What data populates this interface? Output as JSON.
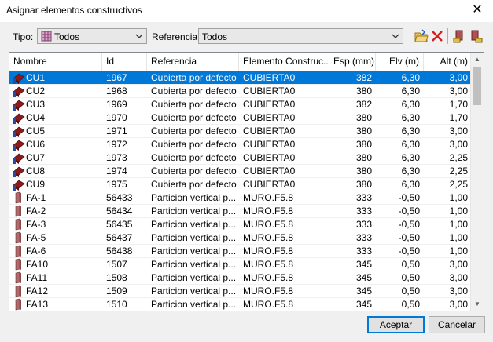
{
  "window": {
    "title": "Asignar elementos constructivos",
    "close_glyph": "✕"
  },
  "filters": {
    "tipo_label": "Tipo:",
    "tipo_value": "Todos",
    "referencia_label": "Referencia:",
    "referencia_value": "Todos"
  },
  "toolbar_icons": [
    "folder-open-icon",
    "delete-x-icon",
    "import-element-icon",
    "export-element-icon"
  ],
  "table": {
    "columns": [
      "Nombre",
      "Id",
      "Referencia",
      "Elemento Construc...",
      "Esp (mm)",
      "Elv (m)",
      "Alt (m)"
    ],
    "rows": [
      {
        "nombre": "CU1",
        "id": "1967",
        "ref": "Cubierta por defecto",
        "elem": "CUBIERTA0",
        "esp": "382",
        "elv": "6,30",
        "alt": "3,00",
        "kind": "roof",
        "selected": true
      },
      {
        "nombre": "CU2",
        "id": "1968",
        "ref": "Cubierta por defecto",
        "elem": "CUBIERTA0",
        "esp": "380",
        "elv": "6,30",
        "alt": "3,00",
        "kind": "roof"
      },
      {
        "nombre": "CU3",
        "id": "1969",
        "ref": "Cubierta por defecto",
        "elem": "CUBIERTA0",
        "esp": "382",
        "elv": "6,30",
        "alt": "1,70",
        "kind": "roof"
      },
      {
        "nombre": "CU4",
        "id": "1970",
        "ref": "Cubierta por defecto",
        "elem": "CUBIERTA0",
        "esp": "380",
        "elv": "6,30",
        "alt": "1,70",
        "kind": "roof"
      },
      {
        "nombre": "CU5",
        "id": "1971",
        "ref": "Cubierta por defecto",
        "elem": "CUBIERTA0",
        "esp": "380",
        "elv": "6,30",
        "alt": "3,00",
        "kind": "roof"
      },
      {
        "nombre": "CU6",
        "id": "1972",
        "ref": "Cubierta por defecto",
        "elem": "CUBIERTA0",
        "esp": "380",
        "elv": "6,30",
        "alt": "3,00",
        "kind": "roof"
      },
      {
        "nombre": "CU7",
        "id": "1973",
        "ref": "Cubierta por defecto",
        "elem": "CUBIERTA0",
        "esp": "380",
        "elv": "6,30",
        "alt": "2,25",
        "kind": "roof"
      },
      {
        "nombre": "CU8",
        "id": "1974",
        "ref": "Cubierta por defecto",
        "elem": "CUBIERTA0",
        "esp": "380",
        "elv": "6,30",
        "alt": "2,25",
        "kind": "roof"
      },
      {
        "nombre": "CU9",
        "id": "1975",
        "ref": "Cubierta por defecto",
        "elem": "CUBIERTA0",
        "esp": "380",
        "elv": "6,30",
        "alt": "2,25",
        "kind": "roof"
      },
      {
        "nombre": "FA-1",
        "id": "56433",
        "ref": "Particion vertical p...",
        "elem": "MURO.F5.8",
        "esp": "333",
        "elv": "-0,50",
        "alt": "1,00",
        "kind": "wall"
      },
      {
        "nombre": "FA-2",
        "id": "56434",
        "ref": "Particion vertical p...",
        "elem": "MURO.F5.8",
        "esp": "333",
        "elv": "-0,50",
        "alt": "1,00",
        "kind": "wall"
      },
      {
        "nombre": "FA-3",
        "id": "56435",
        "ref": "Particion vertical p...",
        "elem": "MURO.F5.8",
        "esp": "333",
        "elv": "-0,50",
        "alt": "1,00",
        "kind": "wall"
      },
      {
        "nombre": "FA-5",
        "id": "56437",
        "ref": "Particion vertical p...",
        "elem": "MURO.F5.8",
        "esp": "333",
        "elv": "-0,50",
        "alt": "1,00",
        "kind": "wall"
      },
      {
        "nombre": "FA-6",
        "id": "56438",
        "ref": "Particion vertical p...",
        "elem": "MURO.F5.8",
        "esp": "333",
        "elv": "-0,50",
        "alt": "1,00",
        "kind": "wall"
      },
      {
        "nombre": "FA10",
        "id": "1507",
        "ref": "Particion vertical p...",
        "elem": "MURO.F5.8",
        "esp": "345",
        "elv": "0,50",
        "alt": "3,00",
        "kind": "wall"
      },
      {
        "nombre": "FA11",
        "id": "1508",
        "ref": "Particion vertical p...",
        "elem": "MURO.F5.8",
        "esp": "345",
        "elv": "0,50",
        "alt": "3,00",
        "kind": "wall"
      },
      {
        "nombre": "FA12",
        "id": "1509",
        "ref": "Particion vertical p...",
        "elem": "MURO.F5.8",
        "esp": "345",
        "elv": "0,50",
        "alt": "3,00",
        "kind": "wall"
      },
      {
        "nombre": "FA13",
        "id": "1510",
        "ref": "Particion vertical p...",
        "elem": "MURO.F5.8",
        "esp": "345",
        "elv": "0,50",
        "alt": "3,00",
        "kind": "wall"
      }
    ]
  },
  "buttons": {
    "accept": "Aceptar",
    "cancel": "Cancelar"
  },
  "colors": {
    "selection": "#0078d7",
    "roof_icon": "#8b1a1a",
    "wall_icon": "#b06a6a"
  }
}
